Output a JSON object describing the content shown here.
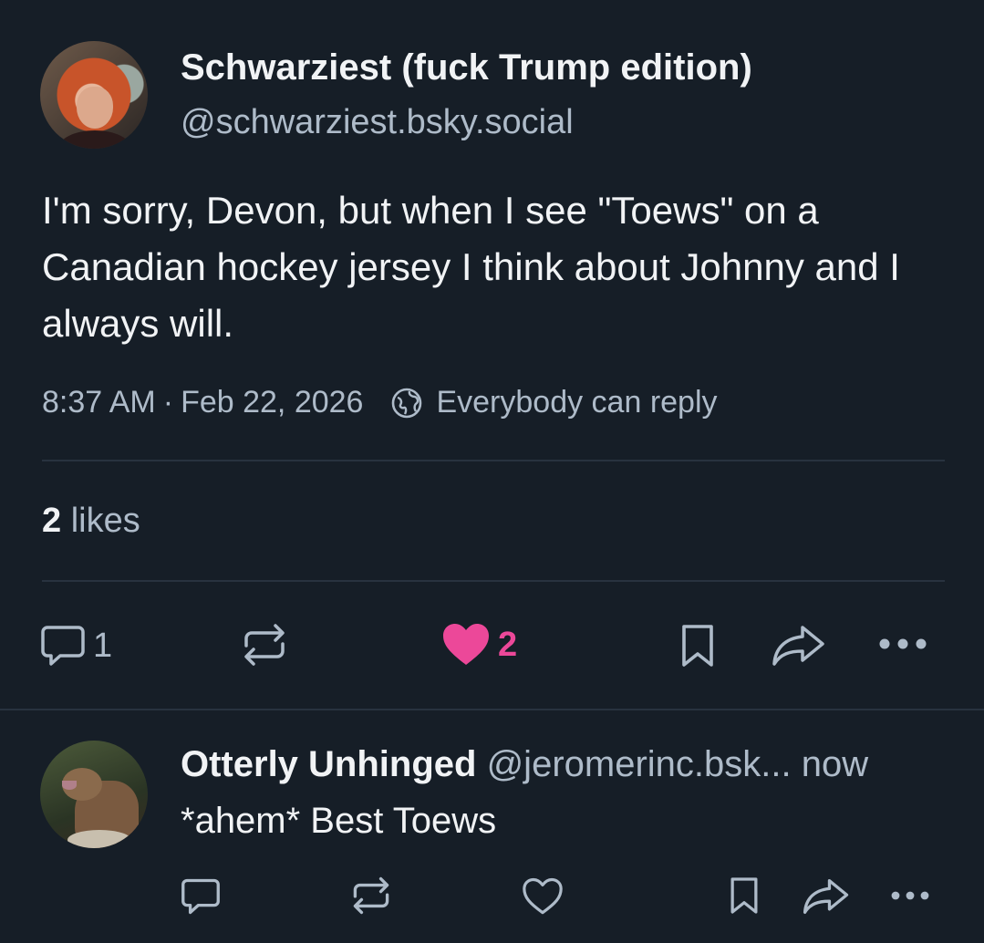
{
  "post": {
    "author_name": "Schwarziest (fuck Trump edition)",
    "author_handle": "@schwarziest.bsky.social",
    "text": "I'm sorry, Devon, but when I see \"Toews\" on a Canadian hockey jersey I think about Johnny and I always will.",
    "time": "8:37 AM",
    "separator": "·",
    "date": "Feb 22, 2026",
    "reply_permission": "Everybody can reply",
    "likes_count": "2",
    "likes_label": "likes",
    "actions": {
      "reply_count": "1",
      "like_count": "2"
    }
  },
  "reply": {
    "author_name": "Otterly Unhinged",
    "author_handle": "@jeromerinc.bsk...",
    "time": "now",
    "text": "*ahem* Best Toews"
  },
  "icons": {
    "reply": "comment-icon",
    "repost": "repost-icon",
    "like": "heart-icon",
    "bookmark": "bookmark-icon",
    "share": "share-icon",
    "more": "more-icon",
    "globe": "globe-icon"
  },
  "colors": {
    "background": "#161e27",
    "text": "#f1f3f5",
    "muted": "#aebbc9",
    "like_active": "#ec4899",
    "divider": "#28323f"
  }
}
